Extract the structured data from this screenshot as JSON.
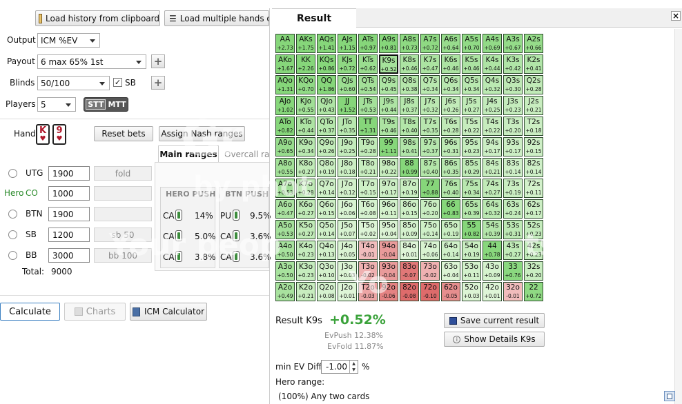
{
  "toolbar": {
    "load_clipboard": "Load history from clipboard",
    "load_multiple": "Load multiple hands o"
  },
  "settings": {
    "output_label": "Output",
    "output_value": "ICM %EV",
    "payout_label": "Payout",
    "payout_value": "6 max 65% 1st",
    "blinds_label": "Blinds",
    "blinds_value": "50/100",
    "sb_check_label": "SB",
    "players_label": "Players",
    "players_value": "5",
    "stt_label": "STT",
    "mtt_label": "MTT"
  },
  "hand": {
    "label": "Hand",
    "card1_rank": "K",
    "card2_rank": "9",
    "suit": "♥",
    "reset_bets": "Reset bets",
    "assign_nash": "Assign Nash ranges"
  },
  "range_tabs": {
    "main": "Main ranges",
    "overcall": "Overcall ra"
  },
  "positions": [
    {
      "name": "UTG",
      "hero": false,
      "stack": "1900",
      "action": "fold"
    },
    {
      "name": "CO",
      "hero": true,
      "hero_label": "Hero",
      "stack": "1000",
      "action": ""
    },
    {
      "name": "BTN",
      "hero": false,
      "stack": "1900",
      "action": ""
    },
    {
      "name": "SB",
      "hero": false,
      "stack": "1200",
      "action": "sb 50"
    },
    {
      "name": "BB",
      "hero": false,
      "stack": "3000",
      "action": "bb 100"
    }
  ],
  "total_label": "Total:",
  "total_value": "9000",
  "hero_push": {
    "title": "HERO PUSH",
    "rows": [
      {
        "k": "CA",
        "v": "14%"
      },
      {
        "k": "CA",
        "v": "5.0%"
      },
      {
        "k": "CA",
        "v": "3.8%"
      }
    ]
  },
  "btn_push": {
    "title": "BTN PUSH",
    "rows": [
      {
        "k": "PU",
        "v": "9.5%"
      },
      {
        "k": "CA",
        "v": "3.6%"
      },
      {
        "k": "CA",
        "v": "3.6%"
      }
    ]
  },
  "bottom": {
    "calculate": "Calculate",
    "charts": "Charts",
    "icm_calc": "ICM Calculator"
  },
  "result": {
    "tab_title": "Result",
    "close": "×",
    "result_label": "Result K9s",
    "result_value": "+0.52%",
    "ev_push": "EvPush 12.38%",
    "ev_fold": "EvFold 11.87%",
    "save": "Save current result",
    "details": "Show Details K9s",
    "min_ev_label": "min EV Diff",
    "min_ev_value": "-1.00",
    "min_ev_unit": "%",
    "hero_range_label": "Hero range:",
    "hero_range_value": "(100%) Any two cards"
  },
  "watermark": {
    "line1": "Gr",
    "line2": "by phot",
    "line3": "Your peop",
    "line3b": "ts.",
    "line4": "Yo"
  },
  "grid": {
    "colors": {
      "pos_light": "#dff5d8",
      "pos_strong": "#86d67a",
      "neg_light": "#f4c8c8",
      "neg_strong": "#de6b6b"
    },
    "rows": [
      [
        "AA|+2.73",
        "AKs|+1.75",
        "AQs|+1.41",
        "AJs|+1.15",
        "ATs|+0.97",
        "A9s|+0.81",
        "A8s|+0.73",
        "A7s|+0.72",
        "A6s|+0.64",
        "A5s|+0.70",
        "A4s|+0.69",
        "A3s|+0.67",
        "A2s|+0.66"
      ],
      [
        "AKo|+1.67",
        "KK|+2.26",
        "KQs|+0.86",
        "KJs|+0.72",
        "KTs|+0.62",
        "K9s|+0.52",
        "K8s|+0.46",
        "K7s|+0.47",
        "K6s|+0.46",
        "K5s|+0.46",
        "K4s|+0.44",
        "K3s|+0.42",
        "K2s|+0.41"
      ],
      [
        "AQo|+1.31",
        "KQo|+0.70",
        "QQ|+1.86",
        "QJs|+0.60",
        "QTs|+0.54",
        "Q9s|+0.45",
        "Q8s|+0.38",
        "Q7s|+0.34",
        "Q6s|+0.34",
        "Q5s|+0.34",
        "Q4s|+0.32",
        "Q3s|+0.30",
        "Q2s|+0.28"
      ],
      [
        "AJo|+1.02",
        "KJo|+0.55",
        "QJo|+0.43",
        "JJ|+1.52",
        "JTs|+0.53",
        "J9s|+0.44",
        "J8s|+0.37",
        "J7s|+0.32",
        "J6s|+0.26",
        "J5s|+0.27",
        "J4s|+0.25",
        "J3s|+0.23",
        "J2s|+0.21"
      ],
      [
        "ATo|+0.82",
        "KTo|+0.44",
        "QTo|+0.37",
        "JTo|+0.35",
        "TT|+1.31",
        "T9s|+0.46",
        "T8s|+0.40",
        "T7s|+0.35",
        "T6s|+0.28",
        "T5s|+0.22",
        "T4s|+0.22",
        "T3s|+0.20",
        "T2s|+0.18"
      ],
      [
        "A9o|+0.65",
        "K9o|+0.34",
        "Q9o|+0.26",
        "J9o|+0.25",
        "T9o|+0.28",
        "99|+1.11",
        "98s|+0.41",
        "97s|+0.37",
        "96s|+0.31",
        "95s|+0.23",
        "94s|+0.17",
        "93s|+0.17",
        "92s|+0.15"
      ],
      [
        "A8o|+0.55",
        "K8o|+0.27",
        "Q8o|+0.19",
        "J8o|+0.18",
        "T8o|+0.21",
        "98o|+0.22",
        "88|+0.99",
        "87s|+0.40",
        "86s|+0.35",
        "85s|+0.29",
        "84s|+0.21",
        "83s|+0.14",
        "82s|+0.14"
      ],
      [
        "A7o|+0.53",
        "K7o|+0.28",
        "Q7o|+0.14",
        "J7o|+0.12",
        "T7o|+0.15",
        "97o|+0.17",
        "87o|+0.19",
        "77|+0.88",
        "76s|+0.40",
        "75s|+0.34",
        "74s|+0.27",
        "73s|+0.19",
        "72s|+0.11"
      ],
      [
        "A6o|+0.47",
        "K6o|+0.27",
        "Q6o|+0.15",
        "J6o|+0.06",
        "T6o|+0.08",
        "96o|+0.11",
        "86o|+0.15",
        "76o|+0.20",
        "66|+0.83",
        "65s|+0.39",
        "64s|+0.32",
        "63s|+0.24",
        "62s|+0.17"
      ],
      [
        "A5o|+0.53",
        "K5o|+0.27",
        "Q5o|+0.14",
        "J5o|+0.07",
        "T5o|+0.02",
        "95o|+0.04",
        "85o|+0.09",
        "75o|+0.14",
        "65o|+0.19",
        "55|+0.82",
        "54s|+0.39",
        "53s|+0.31",
        "52s|+0.23"
      ],
      [
        "A4o|+0.50",
        "K4o|+0.23",
        "Q4o|+0.13",
        "J4o|+0.05",
        "T4o|-0.01",
        "94o|-0.04",
        "84o|+0.01",
        "74o|+0.06",
        "64o|+0.14",
        "54o|+0.19",
        "44|+0.78",
        "43s|+0.27",
        "42s|+0.23"
      ],
      [
        "A3o|+0.50",
        "K3o|+0.23",
        "Q3o|+0.10",
        "J3o|+0.03",
        "T3o|-0.02",
        "93o|-0.04",
        "83o|-0.07",
        "73o|-0.02",
        "63o|+0.04",
        "53o|+0.11",
        "43o|+0.09",
        "33|+0.76",
        "32s|+0.20"
      ],
      [
        "A2o|+0.49",
        "K2o|+0.21",
        "Q2o|+0.08",
        "J2o|+0.01",
        "T2o|-0.03",
        "92o|-0.06",
        "82o|-0.08",
        "72o|-0.10",
        "62o|-0.05",
        "52o|+0.03",
        "42o|+0.01",
        "32o|-0.01",
        "22|+0.72"
      ]
    ]
  }
}
